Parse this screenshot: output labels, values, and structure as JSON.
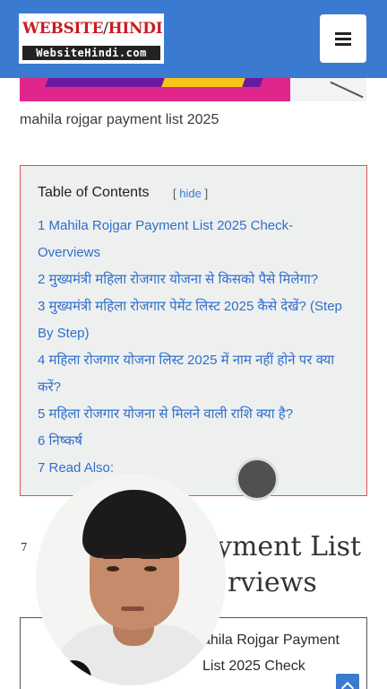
{
  "header": {
    "logo_top_a": "WEBSITE",
    "logo_top_slash": "/",
    "logo_top_b": "HINDI",
    "logo_bottom": "WebsiteHindi.com",
    "menu_icon": "hamburger-menu-icon",
    "background": "#3a7ad1"
  },
  "caption": "mahila rojgar payment list 2025",
  "toc": {
    "title": "Table of Contents",
    "hide_open": "[",
    "hide_label": "hide",
    "hide_close": "]",
    "items": [
      "1 Mahila Rojgar Payment List 2025 Check-Overviews",
      "2 मुख्यमंत्री महिला रोजगार योजना से किसको पैसे मिलेगा?",
      "3 मुख्यमंत्री महिला रोजगार पेमेंट लिस्ट 2025 कैसे देखें? (Step By Step)",
      "4 महिला रोजगार योजना लिस्ट 2025 में नाम नहीं होने पर क्या करें?",
      "5 महिला रोजगार योजना से मिलने वाली राशि क्या है?",
      "6 निष्कर्ष",
      "7 Read Also:"
    ],
    "link_color": "#2f6fcb",
    "border_color": "#d9534f"
  },
  "heading": {
    "marker": "7",
    "line1": "yment List",
    "line2": "rviews"
  },
  "box2": {
    "text": "ahila Rojgar Payment List 2025 Check",
    "scroll_icon": "chevron-up-icon"
  }
}
